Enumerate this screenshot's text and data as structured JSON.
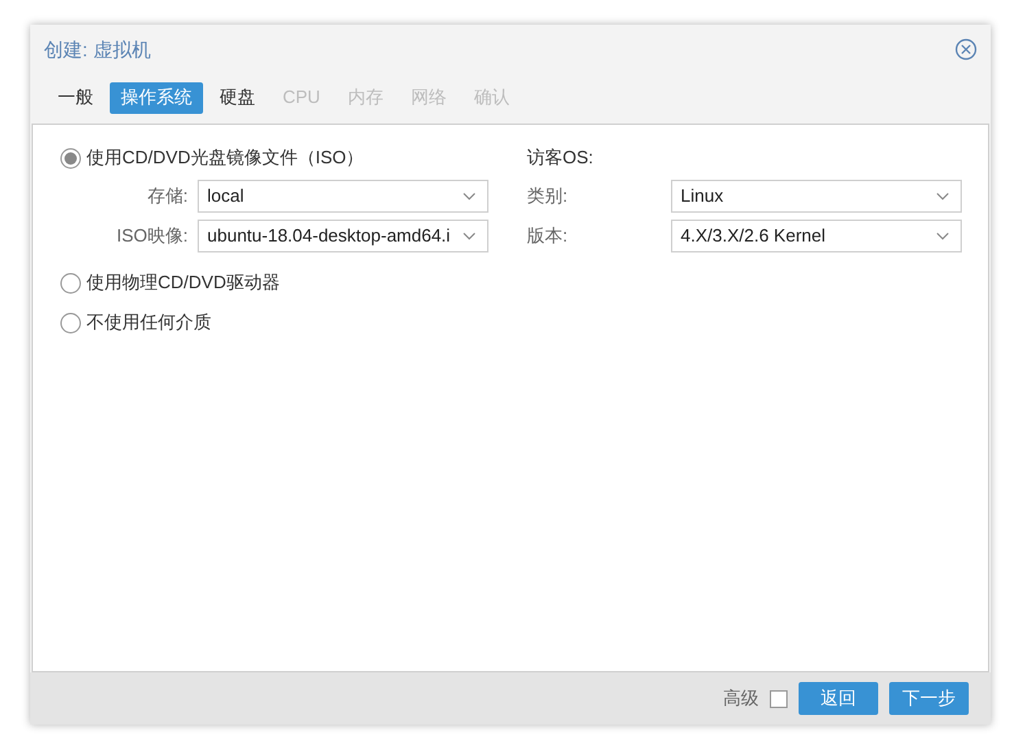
{
  "window": {
    "title": "创建: 虚拟机"
  },
  "tabs": [
    {
      "label": "一般",
      "selected": false,
      "disabled": false
    },
    {
      "label": "操作系统",
      "selected": true,
      "disabled": false
    },
    {
      "label": "硬盘",
      "selected": false,
      "disabled": false
    },
    {
      "label": "CPU",
      "selected": false,
      "disabled": true
    },
    {
      "label": "内存",
      "selected": false,
      "disabled": true
    },
    {
      "label": "网络",
      "selected": false,
      "disabled": true
    },
    {
      "label": "确认",
      "selected": false,
      "disabled": true
    }
  ],
  "media_options": [
    {
      "label": "使用CD/DVD光盘镜像文件（ISO）",
      "selected": true
    },
    {
      "label": "使用物理CD/DVD驱动器",
      "selected": false
    },
    {
      "label": "不使用任何介质",
      "selected": false
    }
  ],
  "iso_fields": [
    {
      "label": "存储:",
      "value": "local"
    },
    {
      "label": "ISO映像:",
      "value": "ubuntu-18.04-desktop-amd64.i"
    }
  ],
  "guest_os": {
    "heading": "访客OS:",
    "fields": [
      {
        "label": "类别:",
        "value": "Linux"
      },
      {
        "label": "版本:",
        "value": "4.X/3.X/2.6 Kernel"
      }
    ]
  },
  "footer": {
    "advanced": {
      "label": "高级",
      "checked": false
    },
    "buttons": [
      "返回",
      "下一步"
    ]
  }
}
